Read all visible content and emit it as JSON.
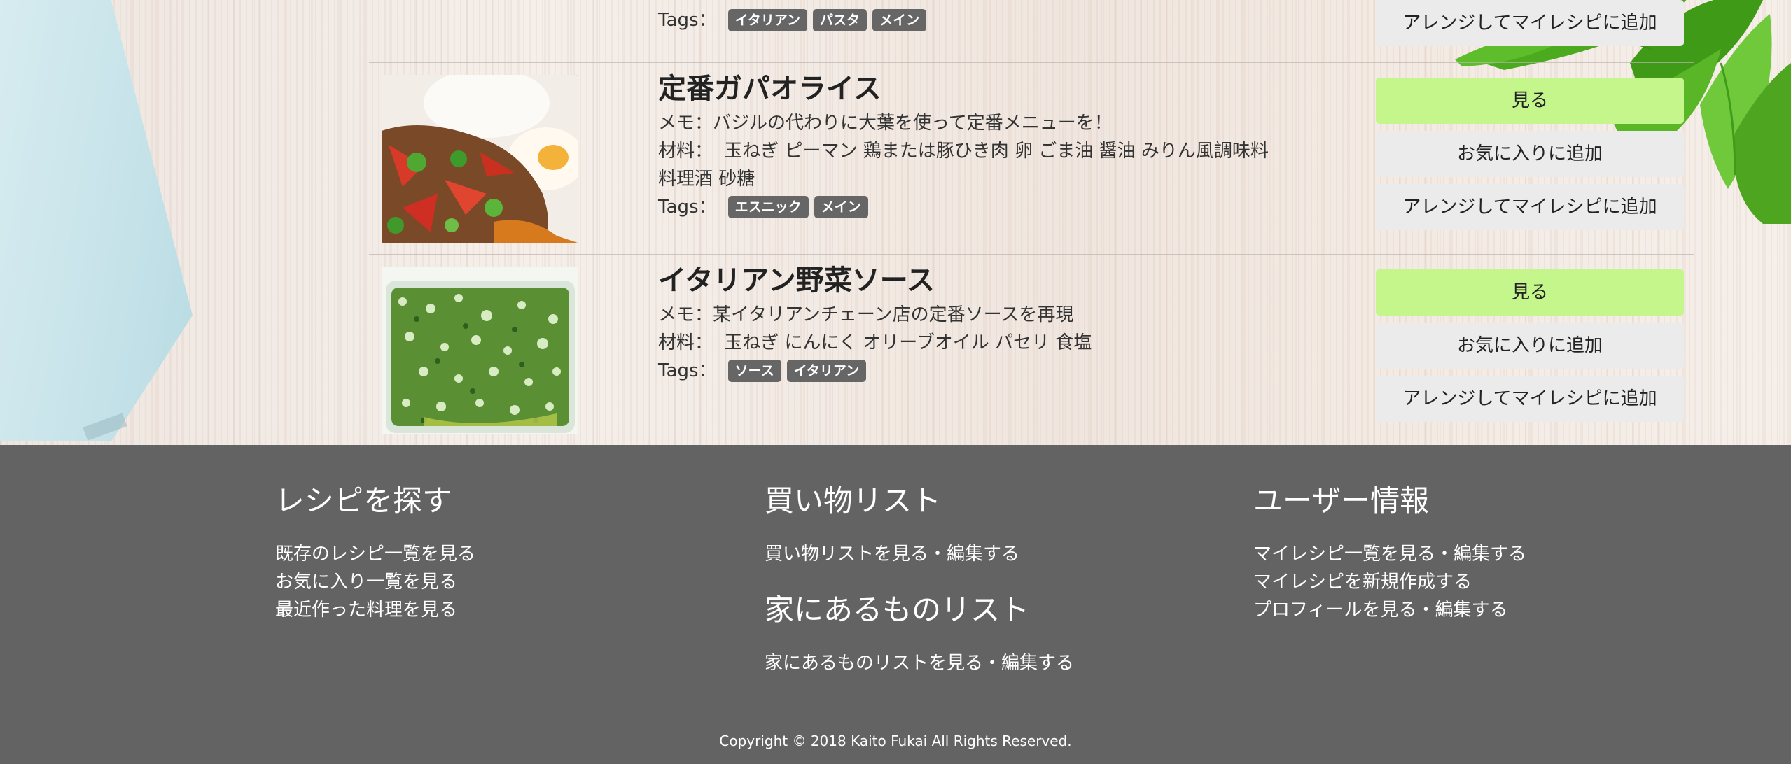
{
  "recipes": [
    {
      "title": "",
      "memo": "",
      "ingredients": "",
      "tags_label": "Tags：",
      "tags": [
        "イタリアン",
        "パスタ",
        "メイン"
      ],
      "buttons": {
        "arrange": "アレンジしてマイレシピに追加"
      }
    },
    {
      "title": "定番ガパオライス",
      "memo": "メモ：バジルの代わりに大葉を使って定番メニューを！",
      "ingredients_label": "材料：",
      "ingredients_line1": "玉ねぎ ピーマン 鶏または豚ひき肉 卵 ごま油 醤油 みりん風調味料",
      "ingredients_line2": "料理酒 砂糖",
      "tags_label": "Tags：",
      "tags": [
        "エスニック",
        "メイン"
      ],
      "buttons": {
        "view": "見る",
        "favorite": "お気に入りに追加",
        "arrange": "アレンジしてマイレシピに追加"
      }
    },
    {
      "title": "イタリアン野菜ソース",
      "memo": "メモ：某イタリアンチェーン店の定番ソースを再現",
      "ingredients_label": "材料：",
      "ingredients_line1": "玉ねぎ にんにく オリーブオイル パセリ 食塩",
      "tags_label": "Tags：",
      "tags": [
        "ソース",
        "イタリアン"
      ],
      "buttons": {
        "view": "見る",
        "favorite": "お気に入りに追加",
        "arrange": "アレンジしてマイレシピに追加"
      }
    }
  ],
  "footer": {
    "find": {
      "heading": "レシピを探す",
      "links": [
        "既存のレシピ一覧を見る",
        "お気に入り一覧を見る",
        "最近作った料理を見る"
      ]
    },
    "shopping": {
      "heading": "買い物リスト",
      "links": [
        "買い物リストを見る・編集する"
      ]
    },
    "home": {
      "heading": "家にあるものリスト",
      "links": [
        "家にあるものリストを見る・編集する"
      ]
    },
    "user": {
      "heading": "ユーザー情報",
      "links": [
        "マイレシピ一覧を見る・編集する",
        "マイレシピを新規作成する",
        "プロフィールを見る・編集する"
      ]
    },
    "copyright": "Copyright © 2018 Kaito Fukai All Rights Reserved."
  },
  "colors": {
    "view_button": "#c5f68c",
    "footer_bg": "#636363",
    "tag_bg": "#666666",
    "secondary_button": "#ebebeb"
  }
}
